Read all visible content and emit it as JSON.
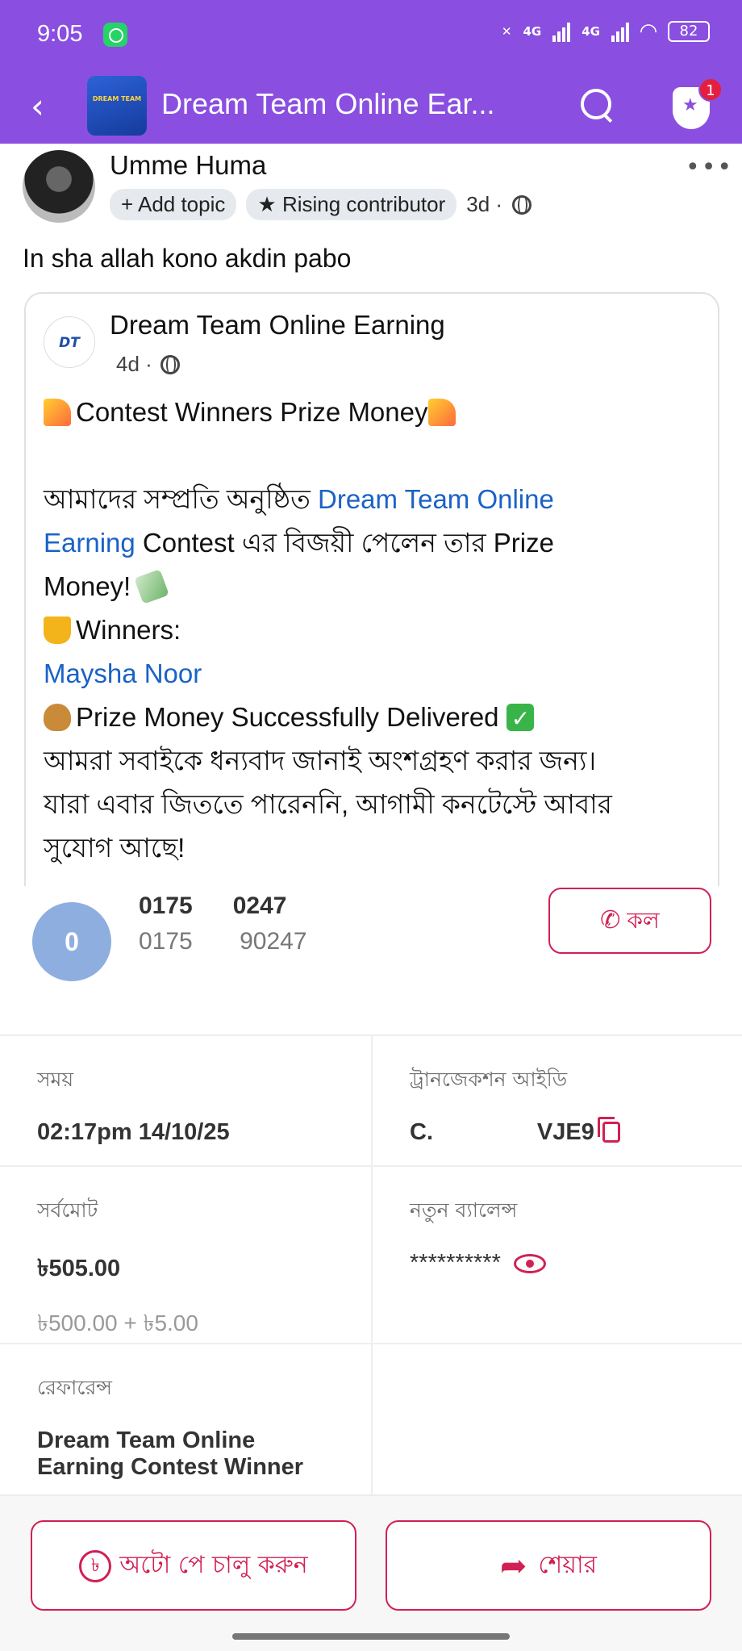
{
  "status_bar": {
    "time": "9:05",
    "network_1": "4G",
    "network_2": "4G",
    "battery": "82"
  },
  "app_bar": {
    "group_title": "Dream Team Online Ear...",
    "group_logo_text": "DREAM TEAM",
    "notification_count": "1",
    "icons": [
      "back-icon",
      "search-icon",
      "shield-icon"
    ]
  },
  "post": {
    "author": "Umme Huma",
    "add_topic": "+ Add topic",
    "badge": "Rising contributor",
    "time": "3d ·",
    "text": "In sha allah kono akdin pabo"
  },
  "shared_post": {
    "logo_text": "DT",
    "page_name": "Dream Team Online Earning",
    "time": "4d ·",
    "line_1": "Contest Winners  Prize Money",
    "line_2_a": "আমাদের সম্প্রতি অনুষ্ঠিত ",
    "line_2_link": "Dream Team Online",
    "line_3_link": "Earning",
    "line_3_b": "   Contest এর বিজয়ী পেলেন তার Prize",
    "line_4": "Money! ",
    "line_5": "Winners:",
    "winner_name": "Maysha Noor",
    "line_7": "Prize Money Successfully Delivered ",
    "line_8": "আমরা সবাইকে ধন্যবাদ জানাই অংশগ্রহণ করার জন্য।",
    "line_9": "যারা এবার জিততে পারেননি, আগামী কনটেস্টে আবার",
    "line_10": "সুযোগ আছে!"
  },
  "receipt": {
    "avatar_letter": "0",
    "number_primary": "0175      0247",
    "number_secondary": "0175       90247",
    "call_label": "কল",
    "time_label": "সময়",
    "time_value": "02:17pm 14/10/25",
    "trx_label": "ট্রানজেকশন আইডি",
    "trx_value": "C.                VJE9",
    "total_label": "সর্বমোট",
    "total_value": "৳505.00",
    "total_breakdown": "৳500.00 + ৳5.00",
    "balance_label": "নতুন ব্যালেন্স",
    "balance_value": "**********",
    "reference_label": "রেফারেন্স",
    "reference_value": "Dream Team Online Earning Contest Winner"
  },
  "actions": {
    "autopay_label": "অটো পে চালু করুন",
    "share_label": "শেয়ার"
  },
  "colors": {
    "header_purple": "#8a4fe0",
    "bkash_pink": "#d12053",
    "link_blue": "#1a62c7"
  }
}
